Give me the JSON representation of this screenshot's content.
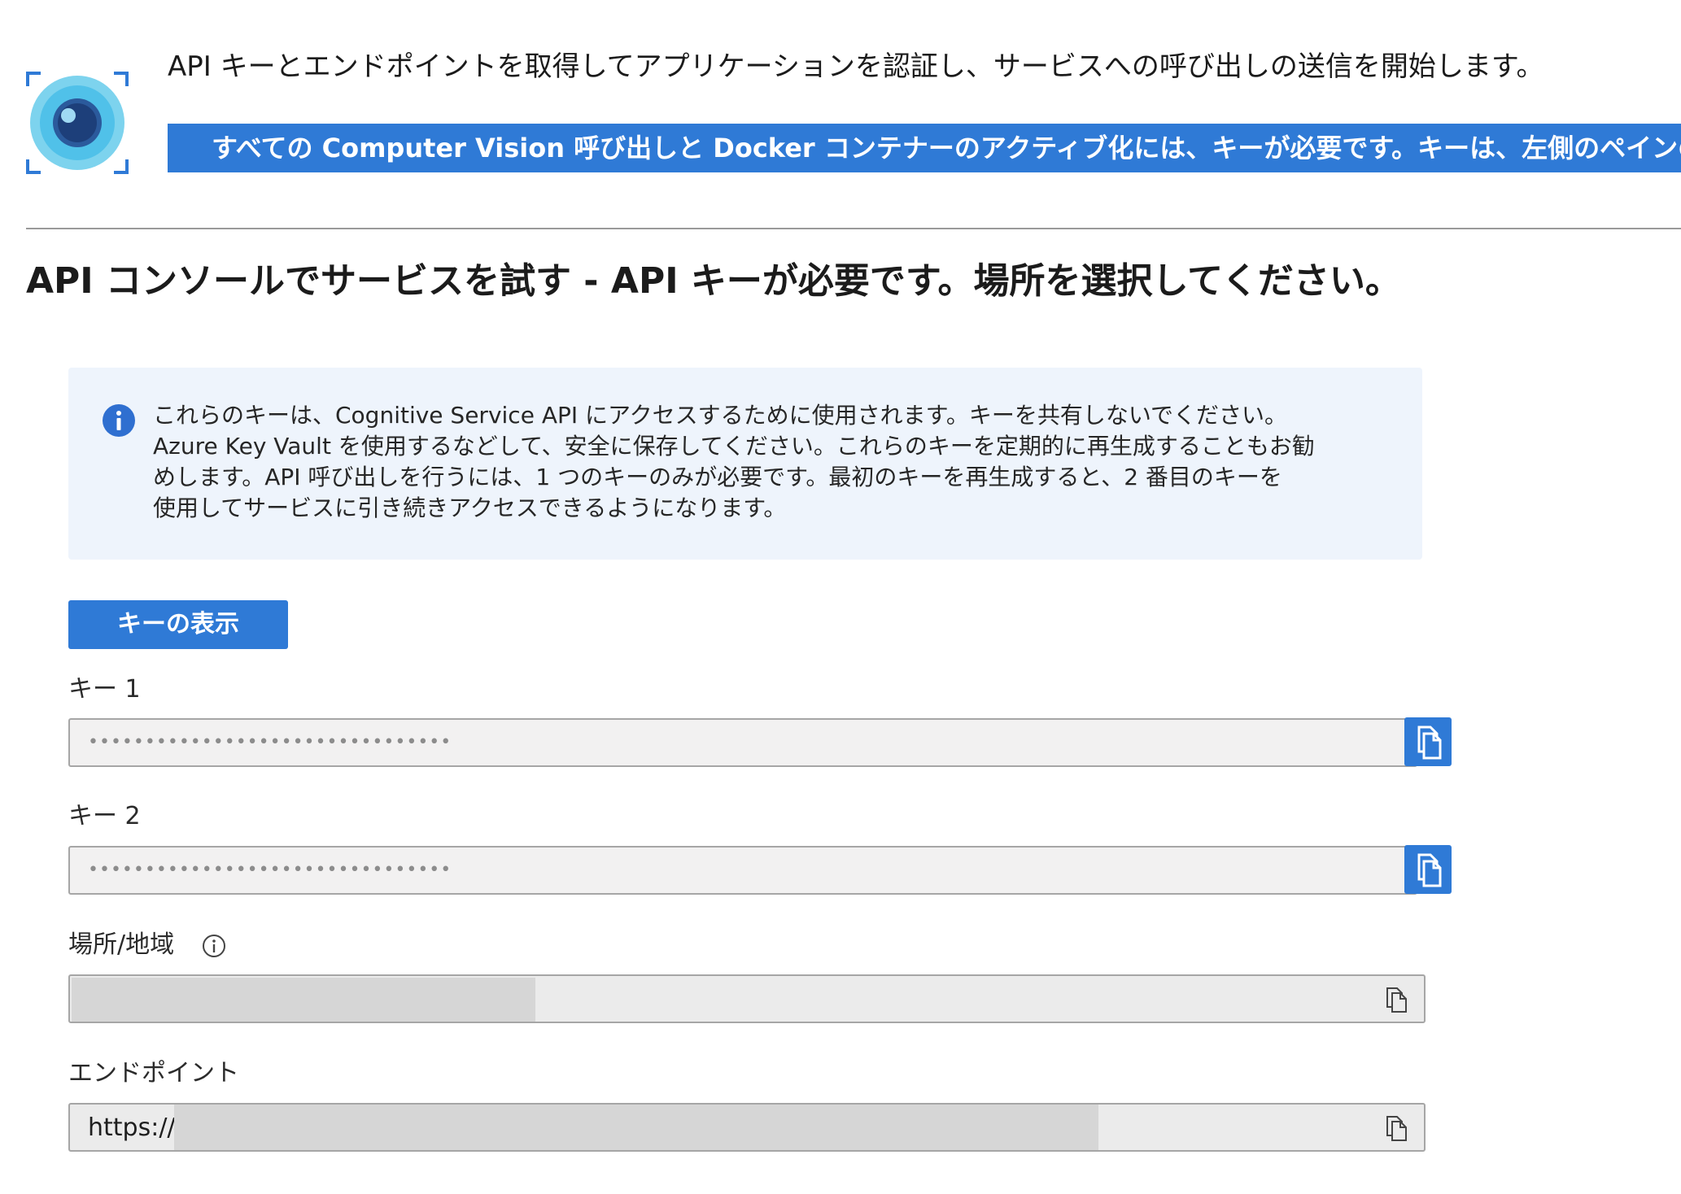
{
  "header": {
    "intro": "API キーとエンドポイントを取得してアプリケーションを認証し、サービスへの呼び出しの送信を開始します。",
    "banner": "すべての Computer Vision 呼び出しと Docker コンテナーのアクティブ化には、キーが必要です。キーは、左側のペインの"
  },
  "section": {
    "title": "API コンソールでサービスを試す - API キーが必要です。場所を選択してください。"
  },
  "info": {
    "lines": [
      "これらのキーは、Cognitive Service API にアクセスするために使用されます。キーを共有しないでください。",
      "Azure Key Vault を使用するなどして、安全に保存してください。これらのキーを定期的に再生成することもお勧",
      "めします。API 呼び出しを行うには、1 つのキーのみが必要です。最初のキーを再生成すると、2 番目のキーを",
      "使用してサービスに引き続きアクセスできるようになります。"
    ]
  },
  "buttons": {
    "show_keys": "キーの表示"
  },
  "fields": {
    "key1": {
      "label": "キー 1",
      "value": "••••••••••••••••••••••••••••••••"
    },
    "key2": {
      "label": "キー 2",
      "value": "••••••••••••••••••••••••••••••••"
    },
    "location": {
      "label": "場所/地域"
    },
    "endpoint": {
      "label": "エンドポイント",
      "value": "https://"
    }
  },
  "colors": {
    "accent": "#2f7ad6",
    "info_bg": "#eef4fc"
  }
}
